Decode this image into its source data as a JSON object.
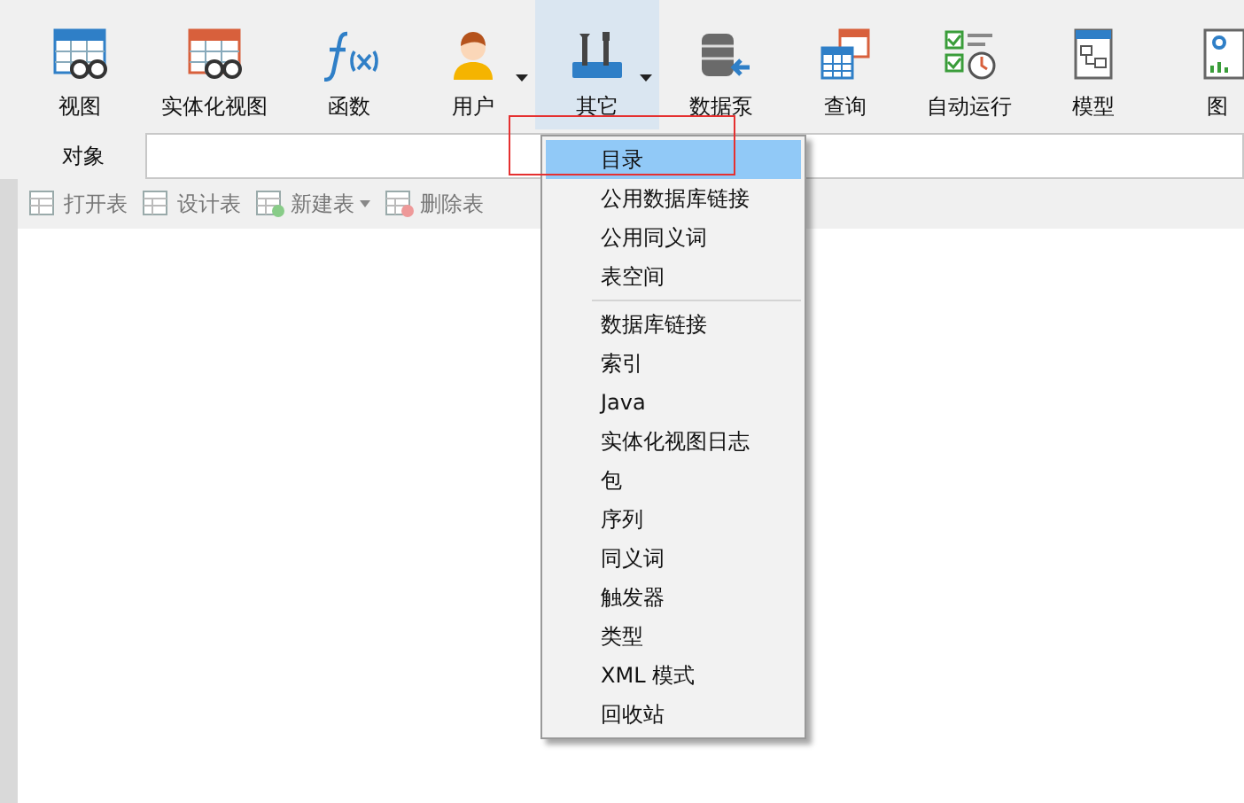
{
  "toolbar": {
    "items": [
      {
        "label": "视图",
        "kind": "view",
        "has_dropdown": false,
        "selected": false
      },
      {
        "label": "实体化视图",
        "kind": "mview",
        "has_dropdown": false,
        "selected": false
      },
      {
        "label": "函数",
        "kind": "function",
        "has_dropdown": false,
        "selected": false
      },
      {
        "label": "用户",
        "kind": "user",
        "has_dropdown": true,
        "selected": false
      },
      {
        "label": "其它",
        "kind": "tools",
        "has_dropdown": true,
        "selected": true
      },
      {
        "label": "数据泵",
        "kind": "pump",
        "has_dropdown": false,
        "selected": false
      },
      {
        "label": "查询",
        "kind": "query",
        "has_dropdown": false,
        "selected": false
      },
      {
        "label": "自动运行",
        "kind": "schedule",
        "has_dropdown": false,
        "selected": false
      },
      {
        "label": "模型",
        "kind": "model",
        "has_dropdown": false,
        "selected": false
      },
      {
        "label": "图",
        "kind": "chart",
        "has_dropdown": false,
        "selected": false
      }
    ]
  },
  "tabs": [
    {
      "label": "对象",
      "selected": true
    }
  ],
  "actions": [
    {
      "label": "打开表",
      "has_dropdown": false,
      "disabled": true
    },
    {
      "label": "设计表",
      "has_dropdown": false,
      "disabled": true
    },
    {
      "label": "新建表",
      "has_dropdown": true,
      "disabled": true
    },
    {
      "label": "删除表",
      "has_dropdown": false,
      "disabled": true
    }
  ],
  "menu": {
    "items": [
      {
        "label": "目录",
        "selected": true,
        "separator_after": false
      },
      {
        "label": "公用数据库链接",
        "selected": false,
        "separator_after": false
      },
      {
        "label": "公用同义词",
        "selected": false,
        "separator_after": false
      },
      {
        "label": "表空间",
        "selected": false,
        "separator_after": true
      },
      {
        "label": "数据库链接",
        "selected": false,
        "separator_after": false
      },
      {
        "label": "索引",
        "selected": false,
        "separator_after": false
      },
      {
        "label": "Java",
        "selected": false,
        "separator_after": false
      },
      {
        "label": "实体化视图日志",
        "selected": false,
        "separator_after": false
      },
      {
        "label": "包",
        "selected": false,
        "separator_after": false
      },
      {
        "label": "序列",
        "selected": false,
        "separator_after": false
      },
      {
        "label": "同义词",
        "selected": false,
        "separator_after": false
      },
      {
        "label": "触发器",
        "selected": false,
        "separator_after": false
      },
      {
        "label": "类型",
        "selected": false,
        "separator_after": false
      },
      {
        "label": "XML 模式",
        "selected": false,
        "separator_after": false
      },
      {
        "label": "回收站",
        "selected": false,
        "separator_after": false
      }
    ]
  },
  "annotation": {
    "kind": "highlight-box"
  }
}
